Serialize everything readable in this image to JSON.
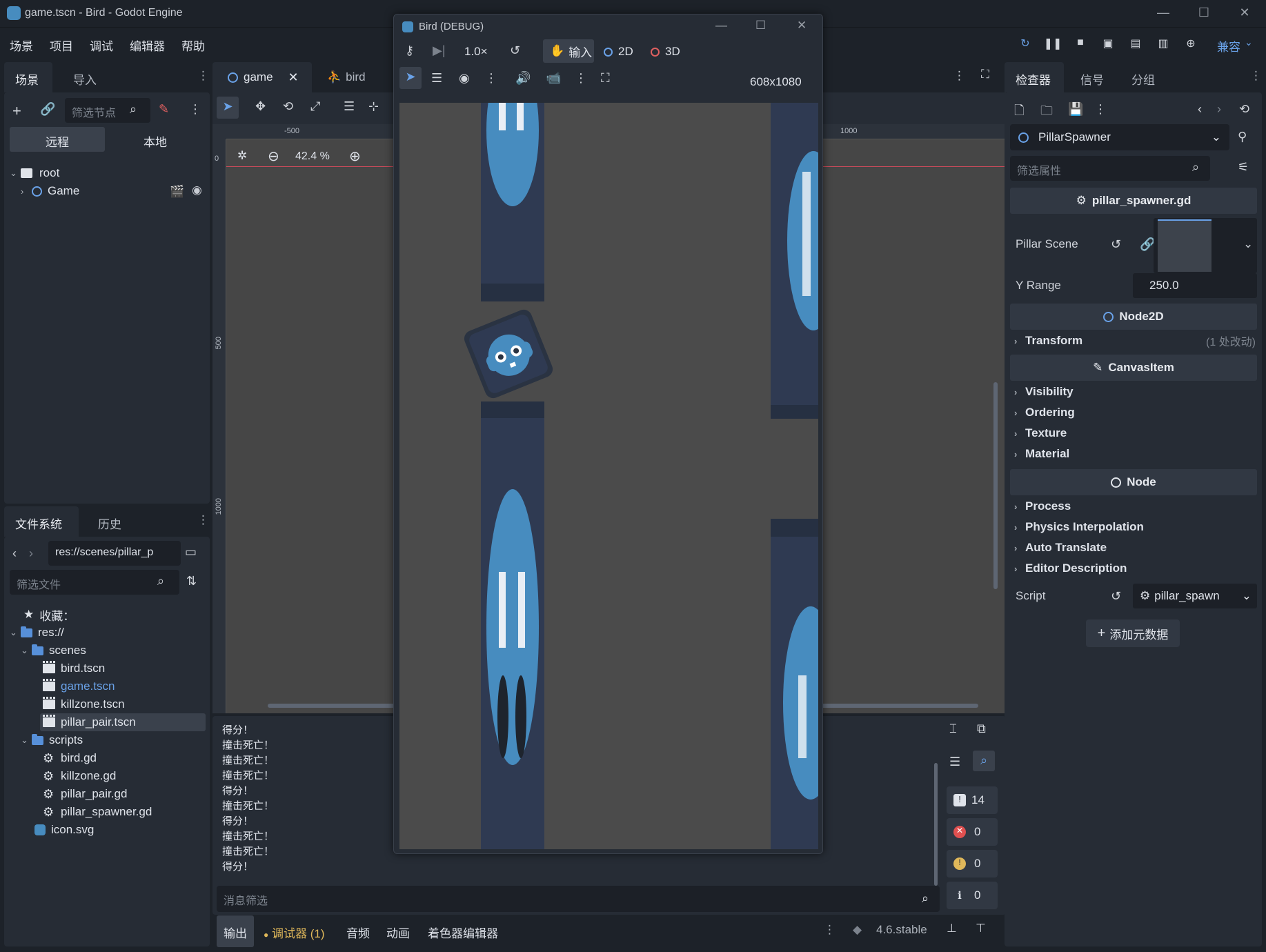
{
  "window": {
    "title": "game.tscn - Bird - Godot Engine",
    "minimize": "—",
    "maximize": "☐",
    "close": "✕"
  },
  "menu": [
    "场景",
    "项目",
    "调试",
    "编辑器",
    "帮助"
  ],
  "renderer": "兼容",
  "scene_dock": {
    "tabs": [
      "场景",
      "导入"
    ],
    "filter_placeholder": "筛选节点",
    "remote_tab": "远程",
    "local_tab": "本地",
    "tree": [
      {
        "label": "root"
      },
      {
        "label": "Game"
      }
    ]
  },
  "filesystem_dock": {
    "tabs": [
      "文件系统",
      "历史"
    ],
    "path": "res://scenes/pillar_p",
    "filter_placeholder": "筛选文件",
    "favorites": "收藏：",
    "items": [
      {
        "label": "res://",
        "type": "folder"
      },
      {
        "label": "scenes",
        "type": "folder"
      },
      {
        "label": "bird.tscn",
        "type": "scene"
      },
      {
        "label": "game.tscn",
        "type": "scene",
        "accent": "#6aa2e8"
      },
      {
        "label": "killzone.tscn",
        "type": "scene"
      },
      {
        "label": "pillar_pair.tscn",
        "type": "scene",
        "selected": true
      },
      {
        "label": "scripts",
        "type": "folder"
      },
      {
        "label": "bird.gd",
        "type": "script"
      },
      {
        "label": "killzone.gd",
        "type": "script"
      },
      {
        "label": "pillar_pair.gd",
        "type": "script"
      },
      {
        "label": "pillar_spawner.gd",
        "type": "script"
      },
      {
        "label": "icon.svg",
        "type": "image"
      }
    ]
  },
  "editor": {
    "tabs": [
      {
        "label": "game"
      },
      {
        "label": "bird"
      }
    ],
    "zoom": "42.4 %",
    "ruler_top": [
      "-500",
      "1000"
    ],
    "ruler_left": [
      "0",
      "500",
      "1000"
    ]
  },
  "debug_window": {
    "title": "Bird (DEBUG)",
    "speed": "1.0×",
    "input_label": "输入",
    "mode_2d": "2D",
    "mode_3d": "3D",
    "resolution": "608x1080"
  },
  "inspector": {
    "tabs": [
      "检查器",
      "信号",
      "分组"
    ],
    "node_name": "PillarSpawner",
    "filter_placeholder": "筛选属性",
    "script_header": "pillar_spawner.gd",
    "pillar_scene_label": "Pillar Scene",
    "y_range_label": "Y Range",
    "y_range_value": "250.0",
    "node2d_header": "Node2D",
    "transform_label": "Transform",
    "transform_note": "(1 处改动)",
    "canvasitem_header": "CanvasItem",
    "canvasitem_groups": [
      "Visibility",
      "Ordering",
      "Texture",
      "Material"
    ],
    "node_header": "Node",
    "node_groups": [
      "Process",
      "Physics Interpolation",
      "Auto Translate",
      "Editor Description"
    ],
    "script_label": "Script",
    "script_value": "pillar_spawn",
    "add_metadata": "添加元数据"
  },
  "output": {
    "lines": [
      "得分！",
      "撞击死亡！",
      "撞击死亡！",
      "撞击死亡！",
      "得分！",
      "撞击死亡！",
      "得分！",
      "撞击死亡！",
      "撞击死亡！",
      "得分！"
    ],
    "filter_placeholder": "消息筛选",
    "counts": {
      "messages": "14",
      "errors": "0",
      "warnings": "0",
      "info": "0"
    }
  },
  "bottom_tabs": [
    "输出",
    "调试器 (1)",
    "音频",
    "动画",
    "着色器编辑器"
  ],
  "version": "4.6.stable",
  "colors": {
    "accent": "#6aa2e8",
    "pillar": "#2f3a52",
    "godot_blue": "#478cbf",
    "debugger_dot": "#e0b85a"
  }
}
